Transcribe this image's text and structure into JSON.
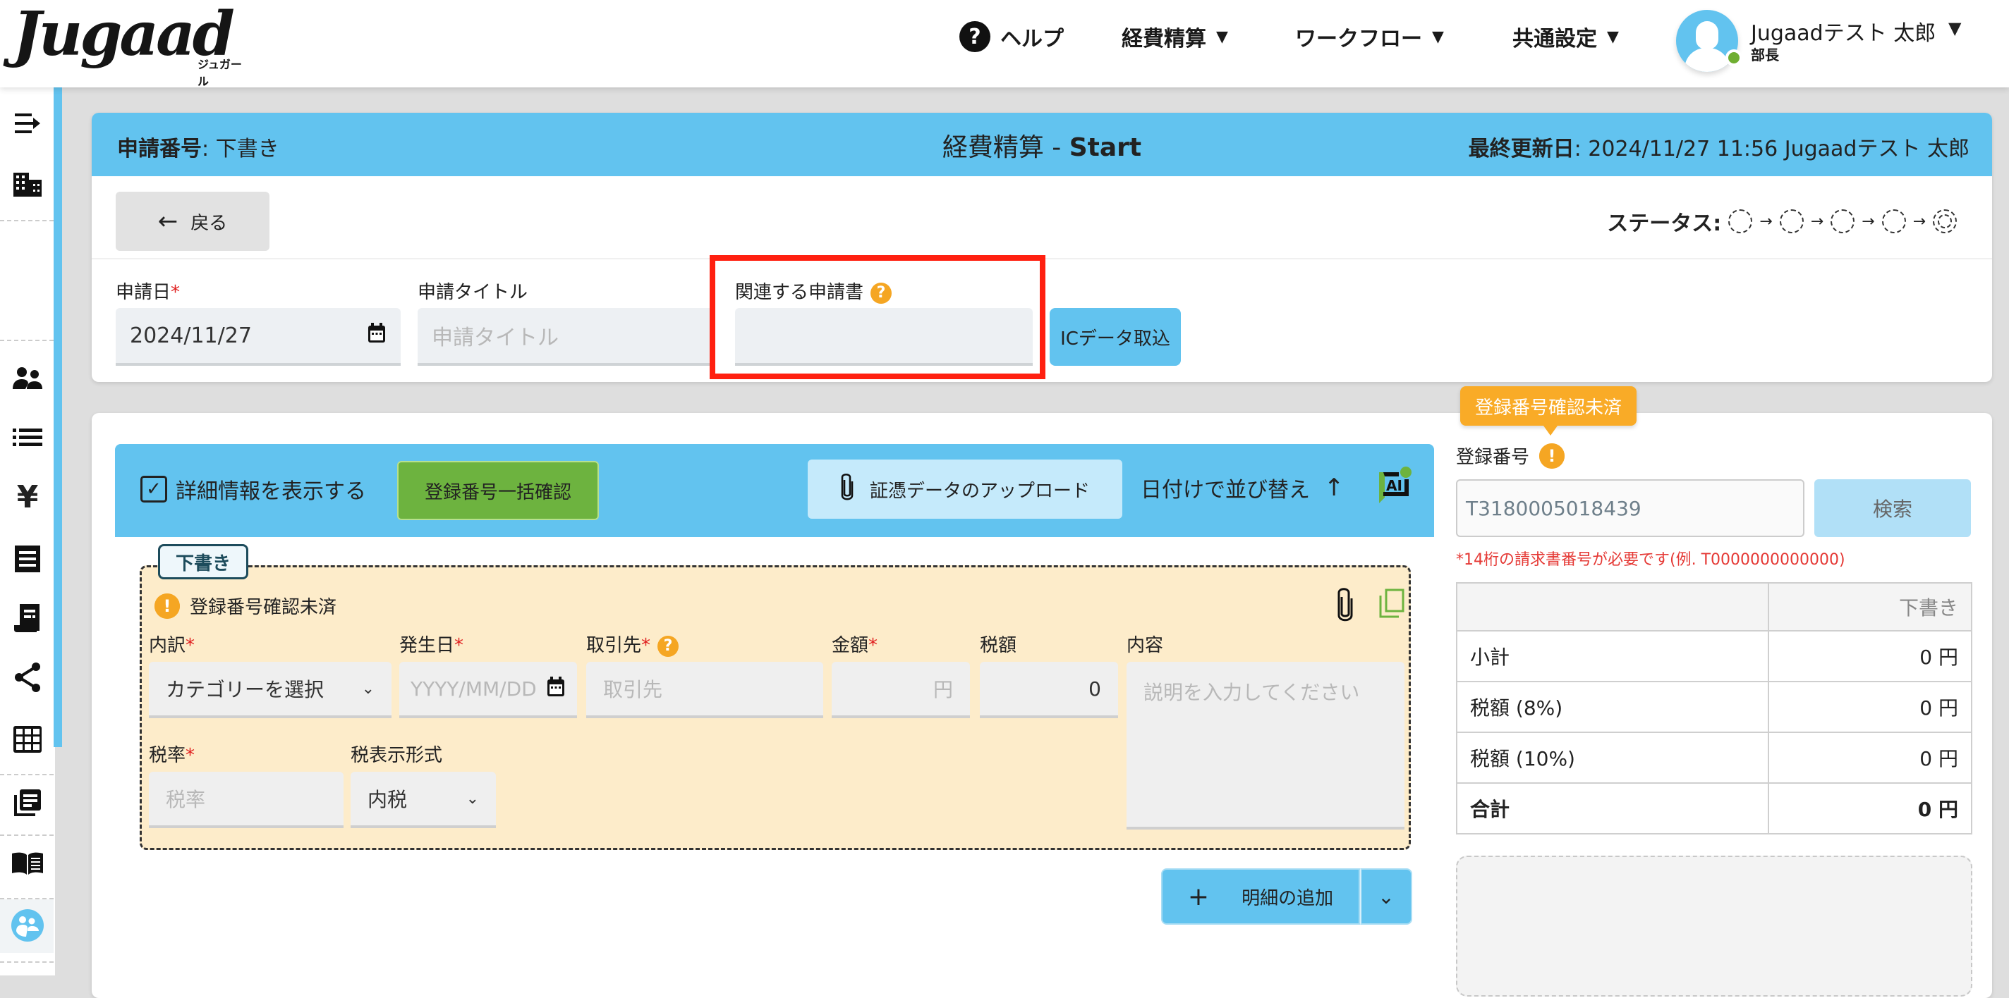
{
  "header": {
    "logo_text": "Jugaad",
    "logo_kana": "ジュガール",
    "nav": [
      {
        "label": "ヘルプ",
        "icon": "help-icon"
      },
      {
        "label": "経費精算",
        "icon": "caret-down-icon"
      },
      {
        "label": "ワークフロー",
        "icon": "caret-down-icon"
      },
      {
        "label": "共通設定",
        "icon": "caret-down-icon"
      }
    ],
    "user": {
      "name": "Jugaadテスト 太郎",
      "role": "部長",
      "presence_color": "#6fae31"
    }
  },
  "sidebar": {
    "icons": [
      "menu-expand-icon",
      "building-icon",
      "people-icon",
      "list-icon",
      "yen-icon",
      "receipt-icon",
      "invoice-icon",
      "share-icon",
      "grid-icon",
      "documents-icon",
      "manual-book-icon",
      "community-icon"
    ]
  },
  "form_header": {
    "app_no_label": "申請番号",
    "app_no_value": ": 下書き",
    "title_prefix": "経費精算 - ",
    "title_bold": "Start",
    "last_updated_label": "最終更新日",
    "last_updated_value": ": 2024/11/27 11:56 Jugaadテスト 太郎",
    "back_label": "戻る",
    "status_label": "ステータス:",
    "status_steps": 5
  },
  "fields": {
    "apply_date": {
      "label": "申請日",
      "value": "2024/11/27"
    },
    "apply_title": {
      "label": "申請タイトル",
      "placeholder": "申請タイトル"
    },
    "related": {
      "label": "関連する申請書",
      "value": ""
    },
    "ic_button": "ICデータ取込"
  },
  "toolbar": {
    "detail_toggle": "詳細情報を表示する",
    "bulk_check": "登録番号一括確認",
    "upload": "証憑データのアップロード",
    "sort": "日付けで並び替え",
    "ai": "AI"
  },
  "line_item": {
    "tag": "下書き",
    "warning": "登録番号確認未済",
    "category": {
      "label": "内訳",
      "value": "カテゴリーを選択"
    },
    "date": {
      "label": "発生日",
      "placeholder": "YYYY/MM/DD"
    },
    "vendor": {
      "label": "取引先",
      "placeholder": "取引先"
    },
    "amount": {
      "label": "金額",
      "placeholder": "円"
    },
    "tax": {
      "label": "税額",
      "value": "0"
    },
    "content": {
      "label": "内容",
      "placeholder": "説明を入力してください"
    },
    "tax_rate": {
      "label": "税率",
      "placeholder": "税率"
    },
    "tax_display": {
      "label": "税表示形式",
      "value": "内税"
    },
    "add_button": "明細の追加"
  },
  "registration": {
    "tooltip": "登録番号確認未済",
    "label": "登録番号",
    "placeholder": "T3180005018439",
    "search": "検索",
    "hint": "*14桁の請求書番号が必要です(例. T0000000000000)"
  },
  "summary": {
    "column": "下書き",
    "rows": [
      {
        "label": "小計",
        "value": "0 円"
      },
      {
        "label": "税額 (8%)",
        "value": "0 円"
      },
      {
        "label": "税額 (10%)",
        "value": "0 円"
      },
      {
        "label": "合計",
        "value": "0 円"
      }
    ]
  },
  "colors": {
    "accent": "#62c3ef",
    "warning": "#f5a623",
    "highlight": "#ff2010",
    "success": "#6db33f",
    "line_item_bg": "#fdecca"
  }
}
